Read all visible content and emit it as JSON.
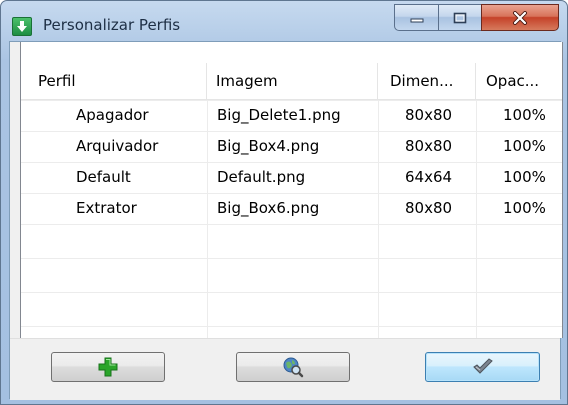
{
  "window": {
    "title": "Personalizar Perfis",
    "icon": "app-down-arrow-icon",
    "controls": [
      "minimize-icon",
      "maximize-icon",
      "close-icon"
    ]
  },
  "listview": {
    "columns": [
      "Perfil",
      "Imagem",
      "Dimen...",
      "Opac..."
    ],
    "rows": [
      {
        "perfil": "Apagador",
        "imagem": "Big_Delete1.png",
        "dimensao": "80x80",
        "opacidade": "100%"
      },
      {
        "perfil": "Arquivador",
        "imagem": "Big_Box4.png",
        "dimensao": "80x80",
        "opacidade": "100%"
      },
      {
        "perfil": "Default",
        "imagem": "Default.png",
        "dimensao": "64x64",
        "opacidade": "100%"
      },
      {
        "perfil": "Extrator",
        "imagem": "Big_Box6.png",
        "dimensao": "80x80",
        "opacidade": "100%"
      }
    ]
  },
  "buttons": {
    "add_icon": "green-plus-icon",
    "browse_icon": "globe-magnifier-icon",
    "ok_icon": "checkmark-icon"
  },
  "colors": {
    "titlebar": "#b8cfe9",
    "close_button": "#c54128",
    "add_icon": "#2aa52a",
    "ok_button": "#bee6fd"
  }
}
